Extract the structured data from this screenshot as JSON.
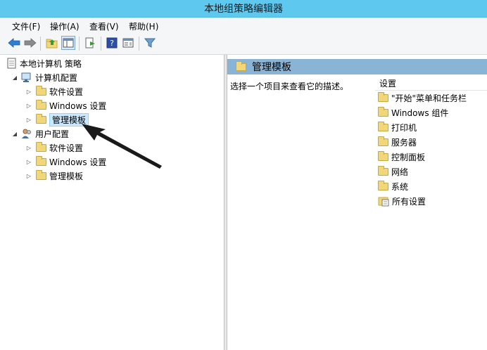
{
  "window": {
    "title": "本地组策略编辑器"
  },
  "menubar": {
    "items": [
      "文件(F)",
      "操作(A)",
      "查看(V)",
      "帮助(H)"
    ]
  },
  "toolbar": {
    "buttons": [
      "back-icon",
      "forward-icon",
      "up-folder-icon",
      "show-hide-tree-icon",
      "export-list-icon",
      "help-icon",
      "properties-icon",
      "filter-icon"
    ]
  },
  "tree": {
    "root": "本地计算机 策略",
    "computer_config": {
      "label": "计算机配置",
      "children": [
        "软件设置",
        "Windows 设置",
        "管理模板"
      ]
    },
    "user_config": {
      "label": "用户配置",
      "children": [
        "软件设置",
        "Windows 设置",
        "管理模板"
      ]
    },
    "selected": "管理模板"
  },
  "details": {
    "header": "管理模板",
    "description": "选择一个项目来查看它的描述。",
    "column_header": "设置",
    "items": [
      "\"开始\"菜单和任务栏",
      "Windows 组件",
      "打印机",
      "服务器",
      "控制面板",
      "网络",
      "系统",
      "所有设置"
    ]
  },
  "colors": {
    "titlebar": "#5fc8ee",
    "details_header": "#8ab4d6",
    "selection": "#cce8ff",
    "folder": "#f1d77a"
  }
}
